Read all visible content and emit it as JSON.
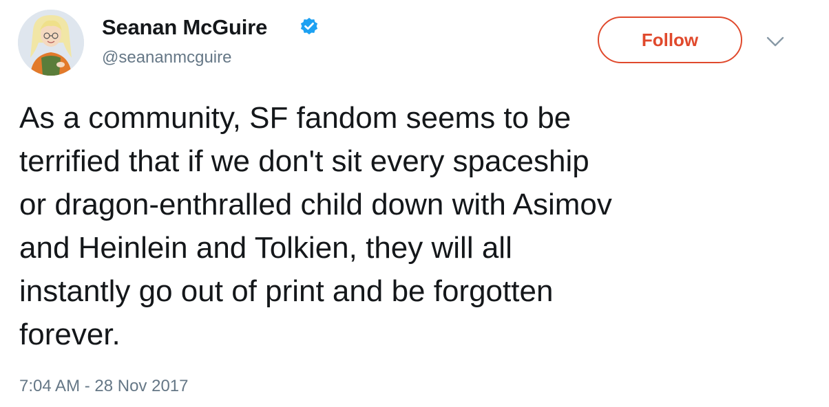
{
  "author": {
    "display_name": "Seanan McGuire",
    "username": "@seananmcguire",
    "verified_icon": "verified-badge-icon",
    "avatar_icon": "profile-avatar"
  },
  "actions": {
    "follow_label": "Follow",
    "more_icon": "chevron-down-icon"
  },
  "tweet": {
    "text": "As a community, SF fandom seems to be\nterrified that if we don't sit every spaceship\nor dragon-enthralled child down with Asimov\nand Heinlein and Tolkien, they will all\ninstantly go out of print and be forgotten\nforever.",
    "timestamp": "7:04 AM - 28 Nov 2017"
  },
  "colors": {
    "follow_accent": "#e0492c",
    "verified_blue": "#1da1f2",
    "secondary_text": "#657786",
    "primary_text": "#14171a"
  }
}
